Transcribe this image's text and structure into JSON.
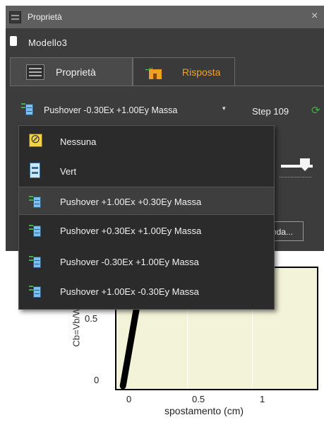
{
  "window": {
    "title": "Proprietà",
    "close_glyph": "×"
  },
  "model": {
    "name": "Modello3"
  },
  "tabs": [
    {
      "label": "Proprietà",
      "icon": "list-icon",
      "active": false
    },
    {
      "label": "Risposta",
      "icon": "house-icon",
      "active": true
    }
  ],
  "combo": {
    "selected": "Pushover -0.30Ex +1.00Ey Massa",
    "caret": "▾"
  },
  "step": {
    "label": "Step 109"
  },
  "dropdown": {
    "items": [
      {
        "label": "Nessuna",
        "icon": "nessuna-icon",
        "selected": false
      },
      {
        "label": "Vert",
        "icon": "building-icon",
        "selected": false
      },
      {
        "label": "Pushover +1.00Ex +0.30Ey Massa",
        "icon": "pushover-icon",
        "selected": true
      },
      {
        "label": "Pushover +0.30Ex +1.00Ey Massa",
        "icon": "pushover-icon",
        "selected": false
      },
      {
        "label": "Pushover -0.30Ex +1.00Ey Massa",
        "icon": "pushover-icon",
        "selected": false
      },
      {
        "label": "Pushover +1.00Ex -0.30Ey Massa",
        "icon": "pushover-icon",
        "selected": false
      }
    ]
  },
  "legend_button": {
    "label": "nda..."
  },
  "chart_data": {
    "type": "line",
    "xlabel": "spostamento (cm)",
    "ylabel": "Cb=Vb/W",
    "x_ticks": [
      "0",
      "0.5",
      "1"
    ],
    "y_ticks": [
      "0",
      "0.5"
    ],
    "xlim": [
      -0.05,
      1.5
    ],
    "ylim": [
      -0.02,
      0.8
    ],
    "series": [
      {
        "x": [
          0.0,
          0.02,
          0.05,
          0.08,
          0.11,
          0.13,
          0.15
        ],
        "y": [
          0.0,
          0.1,
          0.25,
          0.4,
          0.55,
          0.65,
          0.72
        ]
      }
    ],
    "colors": {
      "curve": "#000000",
      "marker": "#c0392b",
      "plot_bg": "#f3f3d9"
    }
  }
}
